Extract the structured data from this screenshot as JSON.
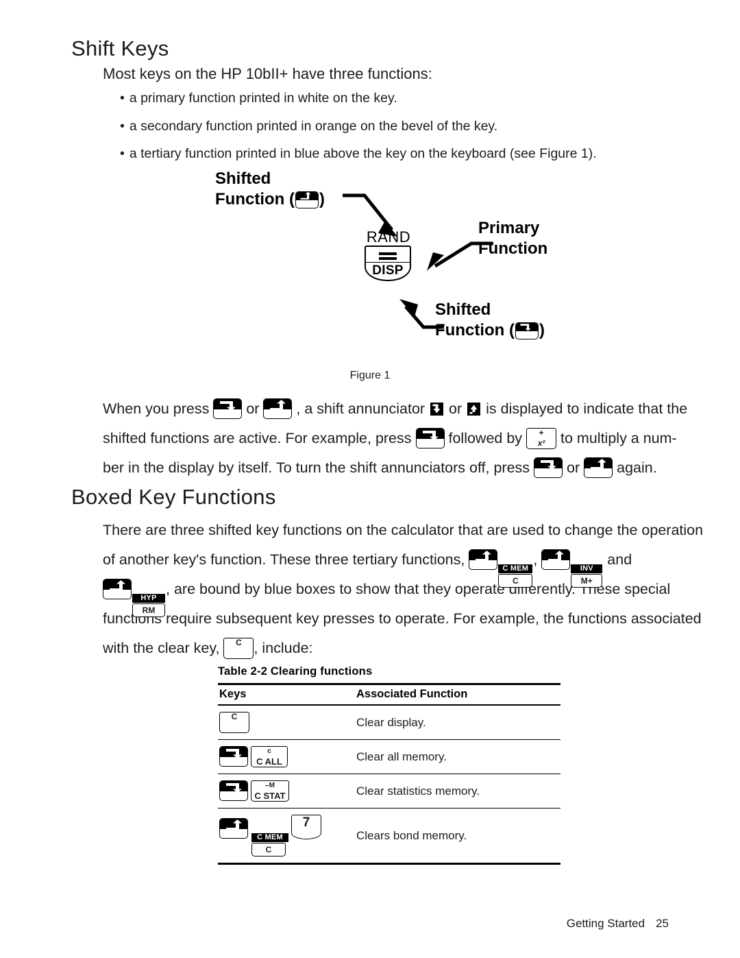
{
  "document": {
    "section_title": "Shift Keys",
    "intro": "Most keys on the HP 10bII+ have three functions:",
    "bullets": [
      "a primary function printed in white on the key.",
      "a secondary function printed in orange on the bevel of the key.",
      "a tertiary function printed in blue above the key on the keyboard (see Figure 1)."
    ],
    "bullet_marker": "•"
  },
  "figure": {
    "caption": "Figure 1",
    "label_top_left_line1": "Shifted",
    "label_top_left_line2_pre": "Function (",
    "label_top_left_line2_post": ")",
    "label_primary_line1": "Primary",
    "label_primary_line2": "Function",
    "label_bottom_right_line1": "Shifted",
    "label_bottom_right_line2_pre": "Function (",
    "label_bottom_right_line2_post": ")",
    "key_tertiary": "RAND",
    "key_primary": "=",
    "key_secondary": "DISP"
  },
  "shift_paragraph": {
    "l1_a": "When you press",
    "l1_b": "or",
    "l1_c": ", a shift annunciator",
    "l1_d": "or",
    "l1_e": "is displayed to indicate that the",
    "l2_a": "shifted functions are active. For example, press",
    "l2_b": "followed by",
    "l2_c": "to multiply a num-",
    "l3_a": "ber in the display by itself. To turn the shift annunciators off, press",
    "l3_b": "or",
    "l3_c": "again."
  },
  "boxed_section": {
    "title": "Boxed Key Functions",
    "l1": "There are three shifted key functions on the calculator that are used to change the operation",
    "l2_a": "of another key's function. These three tertiary functions,",
    "l2_b": ",",
    "l2_c": "and",
    "l3_a": ", are bound by blue boxes to show that they operate differently. These special",
    "l4": "functions require subsequent key presses to operate. For example, the functions associated",
    "l5_a": "with the clear key,",
    "l5_b": ", include:"
  },
  "keys": {
    "shift_orange_name": "orange-shift-key",
    "shift_blue_name": "blue-shift-key",
    "x2": {
      "face": "+",
      "bevel": "x²"
    },
    "clear": {
      "face": "C",
      "bevel": ""
    },
    "c_mem": {
      "tertiary": "C MEM",
      "face": "C",
      "bevel": ""
    },
    "inv": {
      "tertiary": "INV",
      "face": "M+",
      "bevel": ""
    },
    "hyp": {
      "tertiary": "HYP",
      "face": "RM",
      "bevel": ""
    },
    "c_all": {
      "face": "c",
      "bevel": "C ALL"
    },
    "c_stat": {
      "face": "–M",
      "bevel": "C STAT"
    },
    "seven": {
      "face": "7",
      "bevel": ""
    }
  },
  "table": {
    "caption": "Table 2-2  Clearing functions",
    "headers": [
      "Keys",
      "Associated Function"
    ],
    "rows": [
      {
        "function": "Clear display."
      },
      {
        "function": "Clear all memory."
      },
      {
        "function": "Clear statistics memory."
      },
      {
        "function": "Clears bond memory."
      }
    ]
  },
  "footer": {
    "label": "Getting Started",
    "page": "25"
  },
  "colors": {
    "text": "#1c1c1c",
    "rule": "#000000",
    "key_fill": "#ffffff",
    "key_stroke": "#000000",
    "tertiary_box": "#000000"
  }
}
